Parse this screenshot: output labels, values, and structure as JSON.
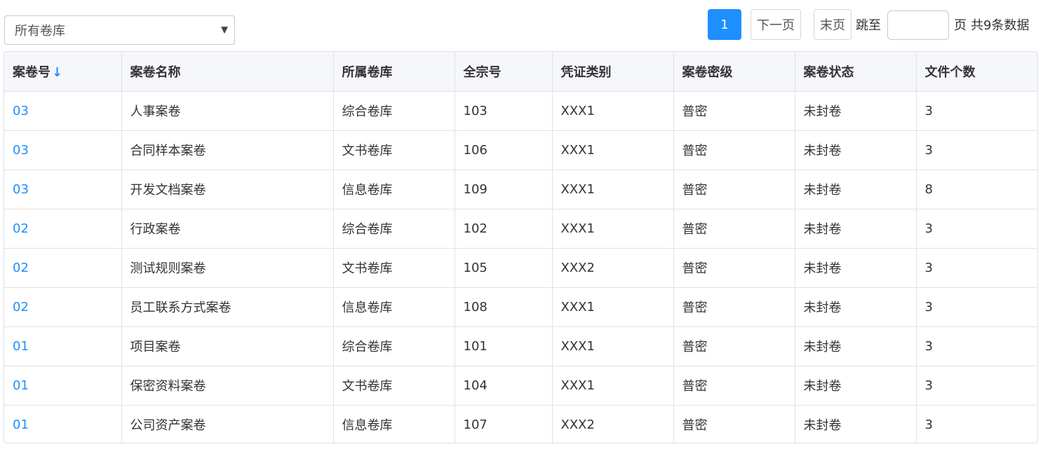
{
  "filter": {
    "selected": "所有卷库",
    "caret_icon": "caret-down-icon"
  },
  "pagination": {
    "current_page": "1",
    "next_label": "下一页",
    "last_label": "末页",
    "jump_label": "跳至",
    "jump_value": "",
    "page_suffix": "页",
    "total_text": "共9条数据"
  },
  "table": {
    "headers": {
      "col1": "案卷号",
      "col1_sort": "↓",
      "col2": "案卷名称",
      "col3": "所属卷库",
      "col4": "全宗号",
      "col5": "凭证类别",
      "col6": "案卷密级",
      "col7": "案卷状态",
      "col8": "文件个数"
    },
    "rows": [
      {
        "no": "03",
        "name": "人事案卷",
        "library": "综合卷库",
        "fonds": "103",
        "voucher": "XXX1",
        "secret": "普密",
        "status": "未封卷",
        "count": "3"
      },
      {
        "no": "03",
        "name": "合同样本案卷",
        "library": "文书卷库",
        "fonds": "106",
        "voucher": "XXX1",
        "secret": "普密",
        "status": "未封卷",
        "count": "3"
      },
      {
        "no": "03",
        "name": "开发文档案卷",
        "library": "信息卷库",
        "fonds": "109",
        "voucher": "XXX1",
        "secret": "普密",
        "status": "未封卷",
        "count": "8"
      },
      {
        "no": "02",
        "name": "行政案卷",
        "library": "综合卷库",
        "fonds": "102",
        "voucher": "XXX1",
        "secret": "普密",
        "status": "未封卷",
        "count": "3"
      },
      {
        "no": "02",
        "name": "测试规则案卷",
        "library": "文书卷库",
        "fonds": "105",
        "voucher": "XXX2",
        "secret": "普密",
        "status": "未封卷",
        "count": "3"
      },
      {
        "no": "02",
        "name": "员工联系方式案卷",
        "library": "信息卷库",
        "fonds": "108",
        "voucher": "XXX1",
        "secret": "普密",
        "status": "未封卷",
        "count": "3"
      },
      {
        "no": "01",
        "name": "项目案卷",
        "library": "综合卷库",
        "fonds": "101",
        "voucher": "XXX1",
        "secret": "普密",
        "status": "未封卷",
        "count": "3"
      },
      {
        "no": "01",
        "name": "保密资料案卷",
        "library": "文书卷库",
        "fonds": "104",
        "voucher": "XXX1",
        "secret": "普密",
        "status": "未封卷",
        "count": "3"
      },
      {
        "no": "01",
        "name": "公司资产案卷",
        "library": "信息卷库",
        "fonds": "107",
        "voucher": "XXX2",
        "secret": "普密",
        "status": "未封卷",
        "count": "3"
      }
    ]
  },
  "colors": {
    "accent": "#1e8fff",
    "header_bg": "#f5f7fb"
  }
}
